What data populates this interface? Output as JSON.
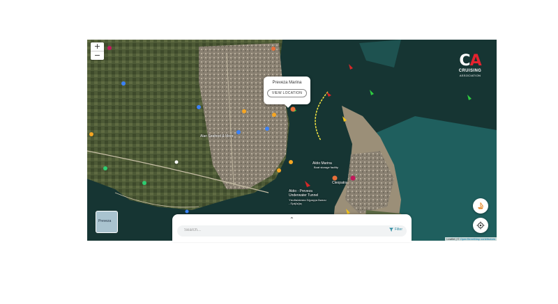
{
  "map": {
    "zoom_in": "+",
    "zoom_out": "−",
    "popup": {
      "title": "Preveza Marina",
      "button": "VIEW LOCATION"
    },
    "labels": {
      "aktio_marina": "Aktio Marina",
      "aktio_marina_sub": "Boat storage facility",
      "cleopatra": "Cleopatra",
      "alan_seafood": "Alan Seafood & More",
      "tunnel": "Aktio - Preveza Underwater Tunnel",
      "tunnel_sub": "Υποθαλάσσια Σήραγγα Άκτιου - Πρέβεζας"
    },
    "minimap_label": "Preveza",
    "attribution_prefix": "Leaflet | © ",
    "attribution_link": "OpenStreetMap contributors"
  },
  "logo": {
    "letters_c": "C",
    "letters_a": "A",
    "line1": "CRUISING",
    "line2": "ASSOCIATION"
  },
  "sheet": {
    "handle": "⌃",
    "search_placeholder": "Search...",
    "filter_label": "Filter"
  },
  "icons": [
    "plus-icon",
    "minus-icon",
    "filter-icon",
    "location-pin-icon",
    "boat-icon",
    "crosshair-icon"
  ],
  "colors": {
    "accent": "#2d8ba1",
    "logo_red": "#e5232e",
    "marker_yellow": "#f5c518",
    "marker_red": "#d62828",
    "marker_green": "#2ecc40"
  }
}
